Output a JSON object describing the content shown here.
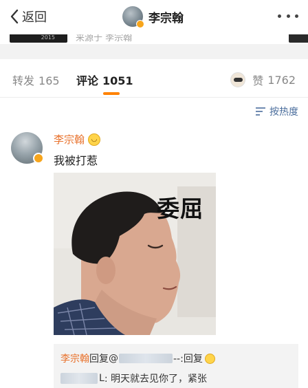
{
  "navbar": {
    "back_label": "返回",
    "title": "李宗翰",
    "more_icon": "more-dots-icon"
  },
  "source": {
    "text": "来源于 李宗翰",
    "thumb_text": "2015"
  },
  "tabs": {
    "repost": {
      "label": "转发",
      "count": "165"
    },
    "comment": {
      "label": "评论",
      "count": "1051",
      "active": true
    },
    "like": {
      "label": "赞",
      "count": "1762"
    }
  },
  "sort": {
    "label": "按热度",
    "icon": "sort-icon"
  },
  "comment": {
    "author": "李宗翰",
    "text": "我被打惹",
    "image_caption": "委屈",
    "reply": {
      "author": "李宗翰",
      "reply_word": "回复",
      "at": "@",
      "after_blur": "--:回复",
      "line2_text": ": 明天就去见你了，紧张",
      "line2_char": "L"
    }
  },
  "colors": {
    "accent": "#ff8200",
    "name": "#e8702a",
    "link": "#4a6d9c"
  }
}
